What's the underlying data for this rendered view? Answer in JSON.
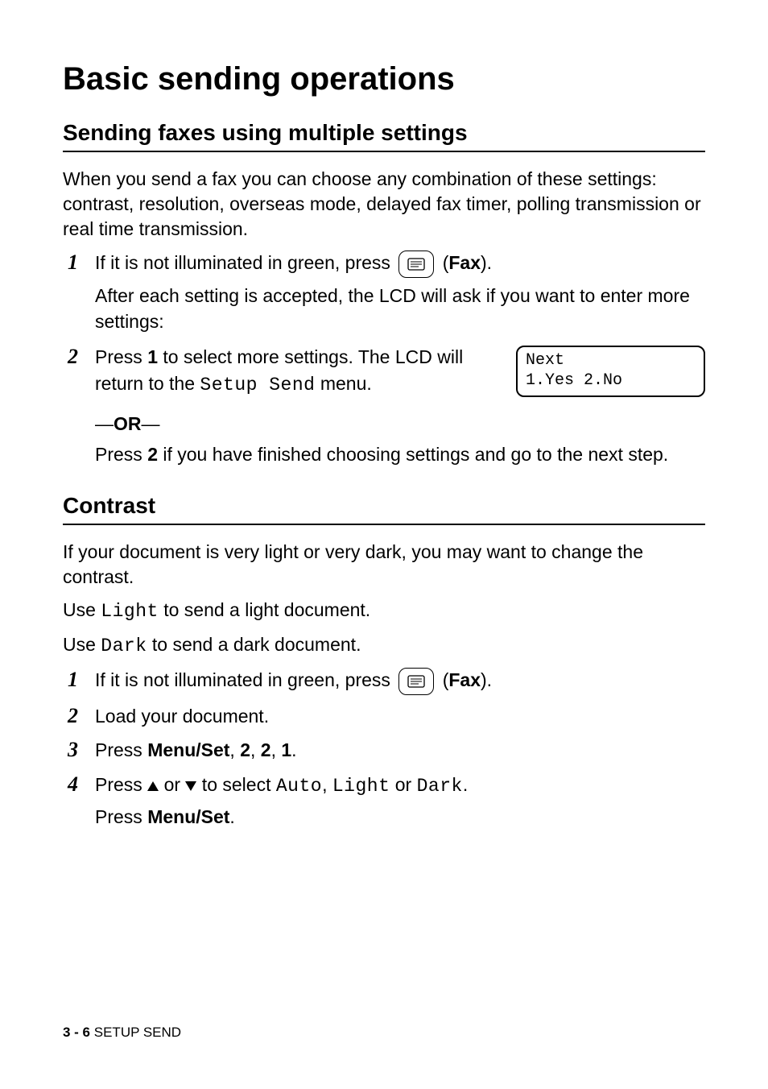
{
  "h1": "Basic sending operations",
  "section1": {
    "h2": "Sending faxes using multiple settings",
    "intro": "When you send a fax you can choose any combination of these settings: contrast, resolution, overseas mode, delayed fax timer, polling transmission or real time transmission.",
    "step1_num": "1",
    "step1_a1": "If it is not illuminated in green, press ",
    "step1_a2": " (",
    "step1_fax": "Fax",
    "step1_a3": ").",
    "step1_b": "After each setting is accepted, the LCD will ask if you want to enter more settings:",
    "step2_num": "2",
    "step2_a1": "Press ",
    "step2_one": "1",
    "step2_a2": " to select more settings. The LCD will return to the ",
    "step2_setup": "Setup Send",
    "step2_a3": " menu.",
    "lcd_line1": "Next",
    "lcd_line2": "1.Yes 2.No",
    "or_dash": "—",
    "or": "OR",
    "step2_b1": "Press ",
    "step2_two": "2",
    "step2_b2": " if you have finished choosing settings and go to the next step."
  },
  "section2": {
    "h2": "Contrast",
    "p1": "If your document is very light or very dark, you may want to change the contrast.",
    "p2a": "Use ",
    "p2_light": "Light",
    "p2b": " to send a light document.",
    "p3a": "Use ",
    "p3_dark": "Dark",
    "p3b": " to send a dark document.",
    "step1_num": "1",
    "step1_a1": "If it is not illuminated in green, press ",
    "step1_a2": " (",
    "step1_fax": "Fax",
    "step1_a3": ").",
    "step2_num": "2",
    "step2": "Load your document.",
    "step3_num": "3",
    "step3_a": "Press ",
    "step3_menu": "Menu/Set",
    "step3_c": ", ",
    "step3_2a": "2",
    "step3_2b": "2",
    "step3_1": "1",
    "step3_dot": ".",
    "step4_num": "4",
    "step4_a": "Press ",
    "step4_b": " or ",
    "step4_c": " to select ",
    "step4_auto": "Auto",
    "step4_comma": ", ",
    "step4_light": "Light",
    "step4_or": " or ",
    "step4_dark": "Dark",
    "step4_dot": ".",
    "step4_p2a": "Press ",
    "step4_p2b": "Menu/Set",
    "step4_p2c": "."
  },
  "footer": {
    "page": "3 - 6",
    "label": "   SETUP SEND"
  }
}
